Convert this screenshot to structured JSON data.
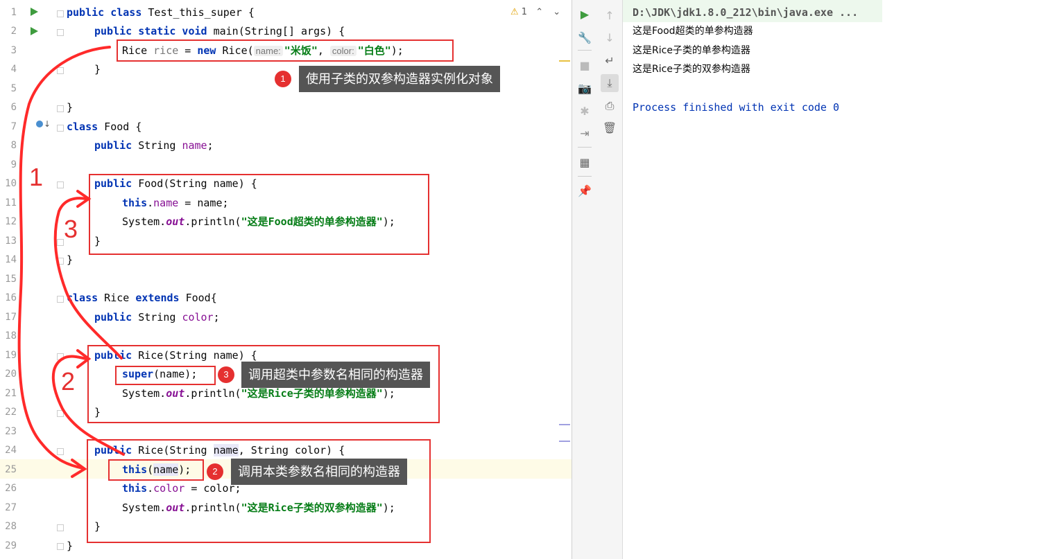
{
  "editor": {
    "inspection_warning_count": "1",
    "line_numbers": [
      "1",
      "2",
      "3",
      "4",
      "5",
      "6",
      "7",
      "8",
      "9",
      "10",
      "11",
      "12",
      "13",
      "14",
      "15",
      "16",
      "17",
      "18",
      "19",
      "20",
      "21",
      "22",
      "23",
      "24",
      "25",
      "26",
      "27",
      "28",
      "29"
    ],
    "code": {
      "l1": [
        "public class",
        " Test_this_super {"
      ],
      "l2": [
        "public static void",
        " main(String[] args) {"
      ],
      "l3": {
        "type": "Rice ",
        "var": "rice",
        " eq": " = ",
        "new": "new",
        " ctor": " Rice(",
        "hint_name": "name:",
        "arg1": "\"米饭\"",
        "comma": ", ",
        "hint_color": "color:",
        "arg2": "\"白色\"",
        "end": ");"
      },
      "l4": "}",
      "l6": "}",
      "l7": [
        "class",
        " Food {"
      ],
      "l8": [
        "public",
        " String ",
        "name",
        ";"
      ],
      "l10": [
        "public",
        " Food(String name) {"
      ],
      "l11": [
        "this",
        ".",
        "name",
        " = name;"
      ],
      "l12": [
        "System.",
        "out",
        ".println(",
        "\"这是Food超类的单参构造器\"",
        ");"
      ],
      "l13": "}",
      "l14": "}",
      "l16": [
        "class",
        " Rice ",
        "extends",
        " Food{"
      ],
      "l17": [
        "public",
        " String ",
        "color",
        ";"
      ],
      "l19": [
        "public",
        " Rice(String name) {"
      ],
      "l20": [
        "super",
        "(name);"
      ],
      "l21": [
        "System.",
        "out",
        ".println(",
        "\"这是Rice子类的单参构造器\"",
        ");"
      ],
      "l22": "}",
      "l24": [
        "public",
        " Rice(String ",
        "name",
        ", String color) {"
      ],
      "l25": [
        "this",
        "(",
        "name",
        ");"
      ],
      "l26": [
        "this",
        ".",
        "color",
        " = color;"
      ],
      "l27": [
        "System.",
        "out",
        ".println(",
        "\"这是Rice子类的双参构造器\"",
        ");"
      ],
      "l28": "}",
      "l29": "}"
    }
  },
  "annotations": {
    "tip1": {
      "badge": "1",
      "text": "使用子类的双参构造器实例化对象"
    },
    "tip2": {
      "badge": "2",
      "text": "调用本类参数名相同的构造器"
    },
    "tip3": {
      "badge": "3",
      "text": "调用超类中参数名相同的构造器"
    },
    "arrow_labels": [
      "1",
      "2",
      "3"
    ]
  },
  "console": {
    "command": "D:\\JDK\\jdk1.8.0_212\\bin\\java.exe ...",
    "output": [
      "这是Food超类的单参构造器",
      "这是Rice子类的单参构造器",
      "这是Rice子类的双参构造器"
    ],
    "exit_message": "Process finished with exit code 0"
  },
  "colors": {
    "annotation_red": "#e53030",
    "keyword": "#0033b3",
    "string": "#067d17",
    "field": "#871094",
    "run_green": "#3f9c3f"
  },
  "icons": [
    "run-icon",
    "wrench-icon",
    "stop-icon",
    "camera-icon",
    "debug-icon",
    "exit-icon",
    "layout-icon",
    "pin-icon",
    "arrow-up-icon",
    "arrow-down-icon",
    "soft-wrap-icon",
    "scroll-to-end-icon",
    "print-icon",
    "trash-icon",
    "warning-icon"
  ]
}
